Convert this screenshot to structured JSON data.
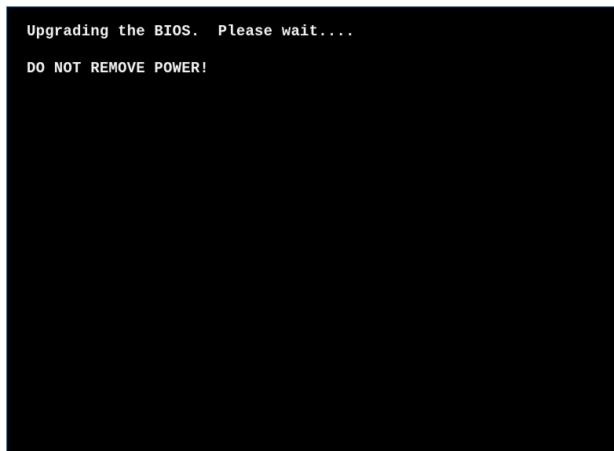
{
  "console": {
    "line1": "Upgrading the BIOS.  Please wait....",
    "line2": "DO NOT REMOVE POWER!"
  }
}
